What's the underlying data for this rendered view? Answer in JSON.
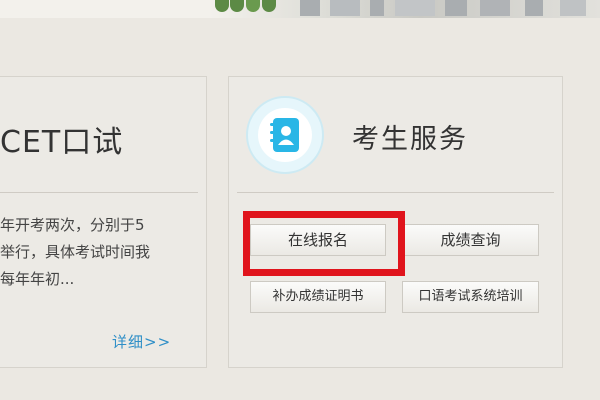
{
  "left_panel": {
    "title": "CET口试",
    "description_lines": [
      "年开考两次，分别于5",
      "举行，具体考试时间我",
      "每年年初..."
    ],
    "detail_link": "详细>>"
  },
  "right_panel": {
    "icon": "address-book-icon",
    "title": "考生服务",
    "buttons": {
      "register": "在线报名",
      "score_query": "成绩查询",
      "certificate": "补办成绩证明书",
      "training": "口语考试系统培训"
    }
  },
  "colors": {
    "background": "#ebe8e2",
    "accent_icon": "#29b6e6",
    "highlight": "#e0141c",
    "link": "#2f8fc7"
  }
}
